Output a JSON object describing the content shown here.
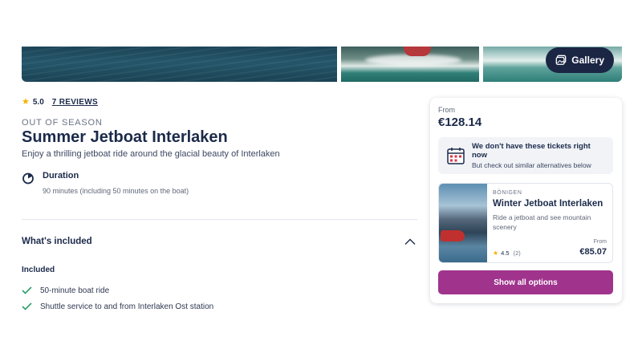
{
  "gallery": {
    "button_label": "Gallery",
    "button_icon": "gallery-icon"
  },
  "product": {
    "rating": "5.0",
    "reviews_link": "7 REVIEWS",
    "season_label": "OUT OF SEASON",
    "title": "Summer Jetboat Interlaken",
    "subtitle": "Enjoy a thrilling jetboat ride around the glacial beauty of Interlaken",
    "duration": {
      "label": "Duration",
      "value": "90 minutes (including 50 minutes on the boat)",
      "icon": "timer-icon"
    }
  },
  "included": {
    "section_title": "What's included",
    "expanded": true,
    "subheading": "Included",
    "items": [
      "50-minute boat ride",
      "Shuttle service to and from Interlaken Ost station"
    ],
    "check_color": "#2e9e6b"
  },
  "booking": {
    "from_label": "From",
    "price": "€128.14",
    "notice_title": "We don't have these tickets right now",
    "notice_sub": "But check out similar alternatives below",
    "alternative": {
      "location": "BÖNIGEN",
      "title": "Winter Jetboat Interlaken",
      "description": "Ride a jetboat and see mountain scenery",
      "rating": "4.5",
      "review_count": "(2)",
      "from_label": "From",
      "price": "€85.07"
    },
    "cta_label": "Show all options",
    "cta_color": "#a0348d"
  }
}
